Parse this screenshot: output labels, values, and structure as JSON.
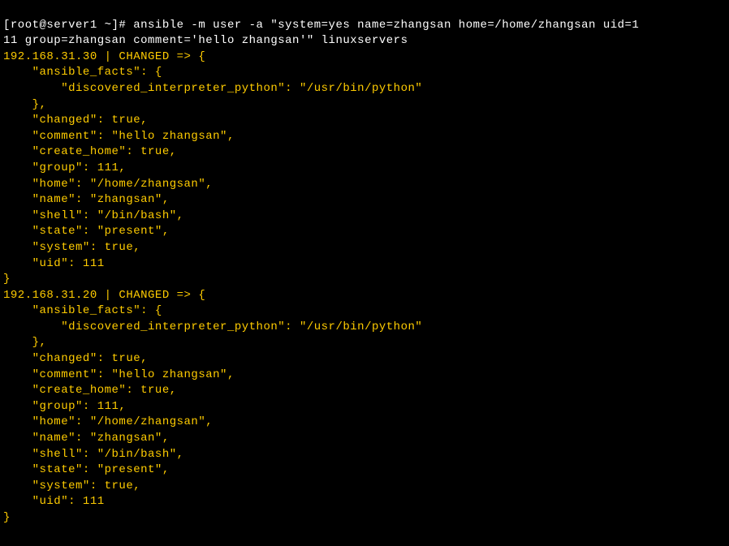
{
  "prompt_line1": "[root@server1 ~]# ansible -m user -a \"system=yes name=zhangsan home=/home/zhangsan uid=1",
  "prompt_line2": "11 group=zhangsan comment='hello zhangsan'\" linuxservers",
  "host1": {
    "header": "192.168.31.30 | CHANGED => {",
    "ansible_facts_open": "    \"ansible_facts\": {",
    "interpreter": "        \"discovered_interpreter_python\": \"/usr/bin/python\"",
    "ansible_facts_close": "    },",
    "changed": "    \"changed\": true,",
    "comment": "    \"comment\": \"hello zhangsan\",",
    "create_home": "    \"create_home\": true,",
    "group": "    \"group\": 111,",
    "home": "    \"home\": \"/home/zhangsan\",",
    "name": "    \"name\": \"zhangsan\",",
    "shell": "    \"shell\": \"/bin/bash\",",
    "state": "    \"state\": \"present\",",
    "system": "    \"system\": true,",
    "uid": "    \"uid\": 111",
    "close": "}"
  },
  "host2": {
    "header": "192.168.31.20 | CHANGED => {",
    "ansible_facts_open": "    \"ansible_facts\": {",
    "interpreter": "        \"discovered_interpreter_python\": \"/usr/bin/python\"",
    "ansible_facts_close": "    },",
    "changed": "    \"changed\": true,",
    "comment": "    \"comment\": \"hello zhangsan\",",
    "create_home": "    \"create_home\": true,",
    "group": "    \"group\": 111,",
    "home": "    \"home\": \"/home/zhangsan\",",
    "name": "    \"name\": \"zhangsan\",",
    "shell": "    \"shell\": \"/bin/bash\",",
    "state": "    \"state\": \"present\",",
    "system": "    \"system\": true,",
    "uid": "    \"uid\": 111",
    "close": "}"
  }
}
